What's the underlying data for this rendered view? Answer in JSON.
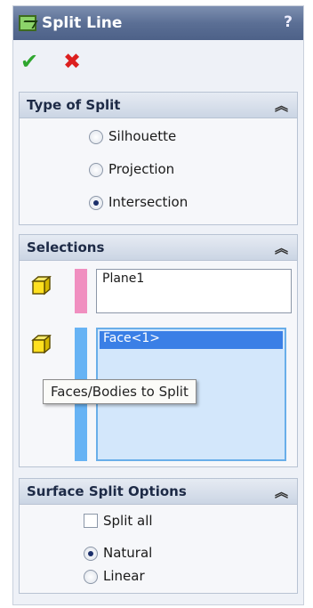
{
  "header": {
    "title": "Split Line",
    "help": "?"
  },
  "actions": {
    "ok_icon": "checkmark-icon",
    "cancel_icon": "x-icon"
  },
  "type_of_split": {
    "title": "Type of Split",
    "options": [
      {
        "label": "Silhouette",
        "checked": false
      },
      {
        "label": "Projection",
        "checked": false
      },
      {
        "label": "Intersection",
        "checked": true
      }
    ]
  },
  "selections": {
    "title": "Selections",
    "plane_list": {
      "items": [
        "Plane1"
      ],
      "color": "#f08fc0"
    },
    "faces_list": {
      "items": [
        "Face<1>"
      ],
      "color": "#67b3f4"
    },
    "tooltip": "Faces/Bodies to Split"
  },
  "surface_split_options": {
    "title": "Surface Split Options",
    "split_all": {
      "label": "Split all",
      "checked": false
    },
    "options": [
      {
        "label": "Natural",
        "checked": true
      },
      {
        "label": "Linear",
        "checked": false
      }
    ]
  },
  "collapse_glyph": "≈"
}
